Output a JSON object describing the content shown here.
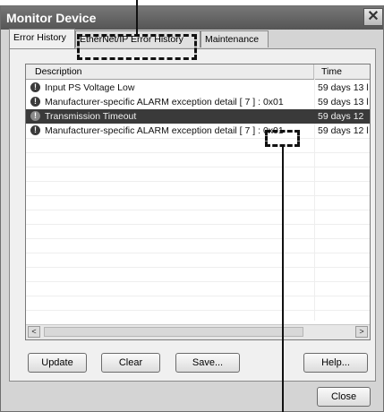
{
  "window": {
    "title": "Monitor Device",
    "close_glyph": "✕"
  },
  "tabs": [
    {
      "label": "Error History",
      "active": true
    },
    {
      "label": "EtherNet/IP Error History",
      "active": false
    },
    {
      "label": "Maintenance",
      "active": false
    }
  ],
  "list": {
    "headers": {
      "description": "Description",
      "time": "Time"
    },
    "rows": [
      {
        "icon": "error-icon",
        "description": "Input PS Voltage Low",
        "time": "59 days 13 l",
        "selected": false
      },
      {
        "icon": "error-icon",
        "description": "Manufacturer-specific ALARM exception detail [ 7 ] : 0x01",
        "time": "59 days 13 l",
        "selected": false
      },
      {
        "icon": "error-icon",
        "description": "Transmission Timeout",
        "time": "59 days 12",
        "selected": true
      },
      {
        "icon": "error-icon",
        "description": "Manufacturer-specific ALARM exception detail [ 7 ] : 0x01",
        "time": "59 days 12 l",
        "selected": false
      }
    ],
    "icon_glyph": "!"
  },
  "buttons": {
    "update": "Update",
    "clear": "Clear",
    "save": "Save...",
    "help": "Help...",
    "close": "Close"
  },
  "scrollbar": {
    "left_glyph": "<",
    "right_glyph": ">"
  }
}
